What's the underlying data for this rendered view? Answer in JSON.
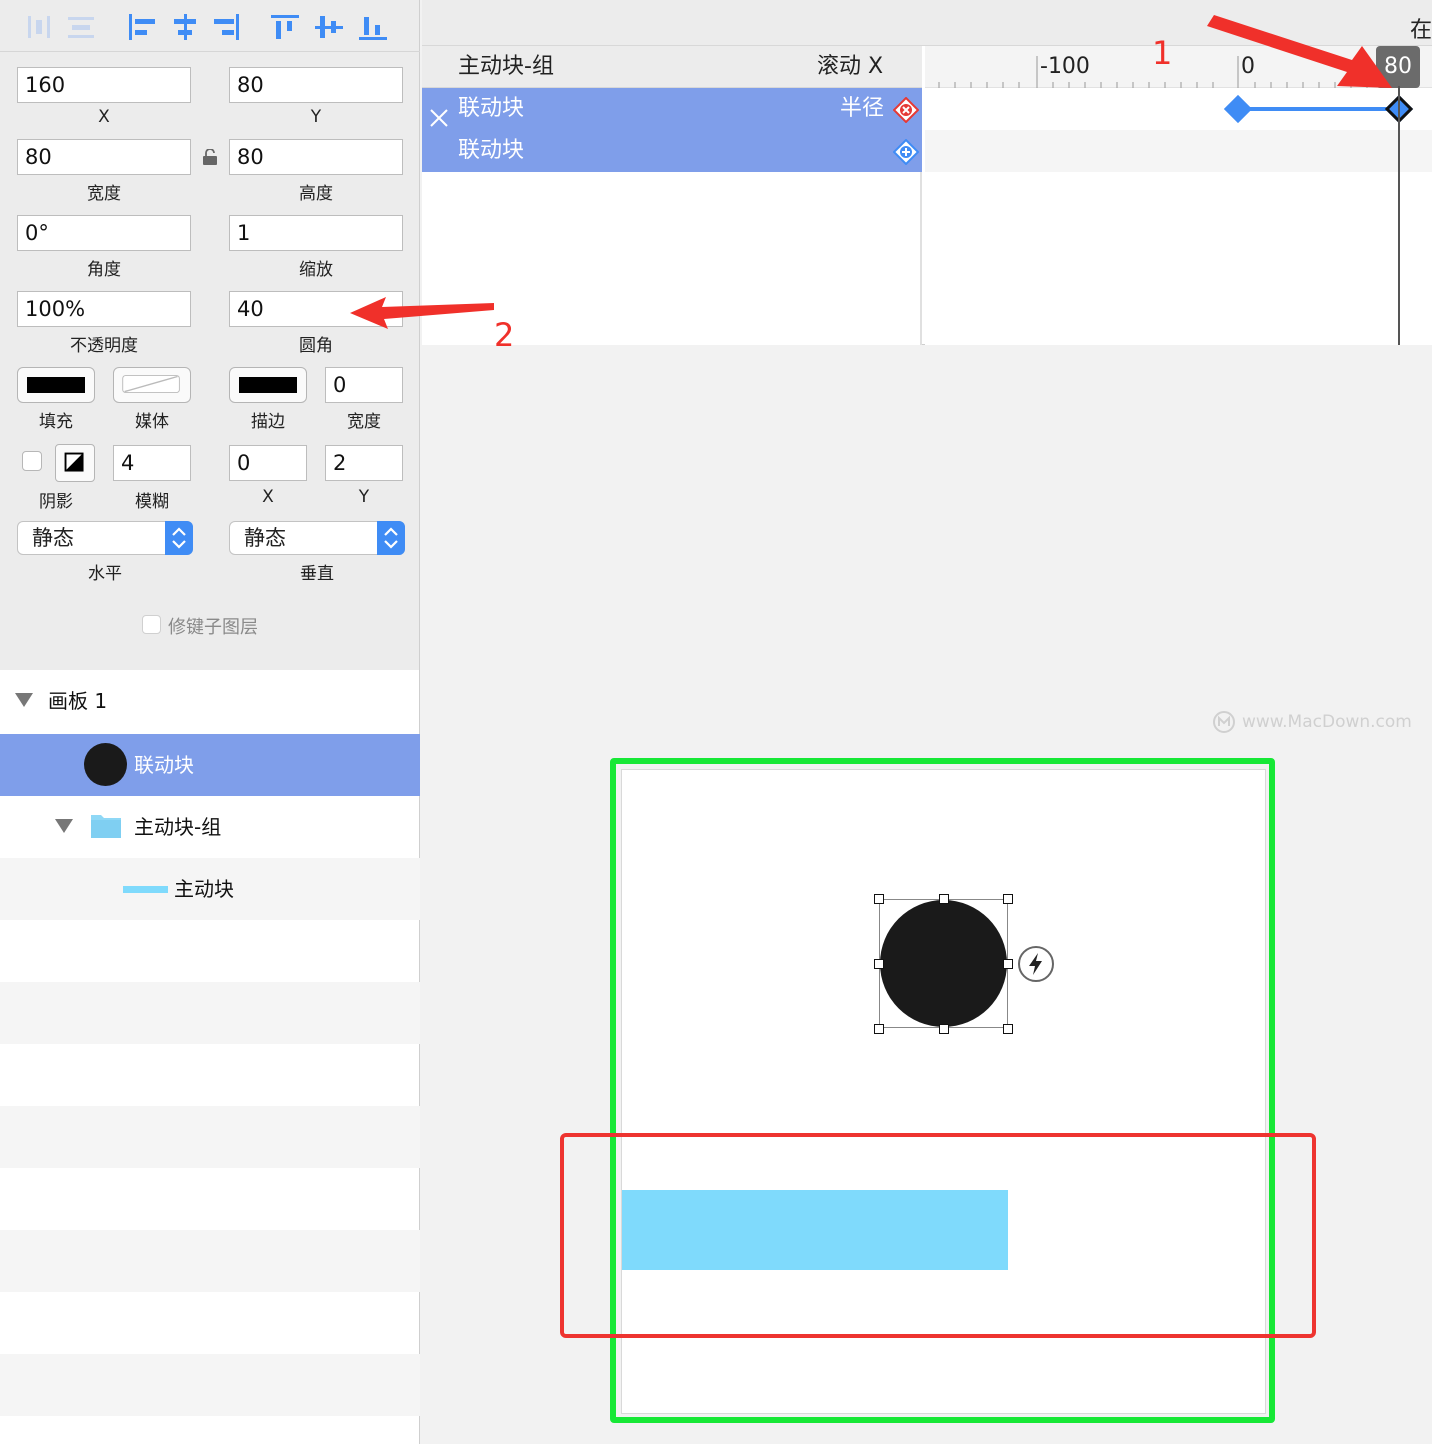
{
  "inspector": {
    "fields": {
      "x": "160",
      "x_label": "X",
      "y": "80",
      "y_label": "Y",
      "width": "80",
      "width_label": "宽度",
      "height": "80",
      "height_label": "高度",
      "angle": "0°",
      "angle_label": "角度",
      "scale": "1",
      "scale_label": "缩放",
      "opacity": "100%",
      "opacity_label": "不透明度",
      "radius": "40",
      "radius_label": "圆角"
    },
    "appearance": {
      "fill_label": "填充",
      "media_label": "媒体",
      "stroke_label": "描边",
      "stroke_width": "0",
      "stroke_width_label": "宽度"
    },
    "shadow": {
      "label": "阴影",
      "blur": "4",
      "blur_label": "模糊",
      "x": "0",
      "x_label": "X",
      "y": "2",
      "y_label": "Y"
    },
    "pins": {
      "horizontal_value": "静态",
      "horizontal_label": "水平",
      "vertical_value": "静态",
      "vertical_label": "垂直"
    },
    "lock_children_label": "修键子图层"
  },
  "layers": {
    "artboard": "画板 1",
    "linked_block": "联动块",
    "group": "主动块-组",
    "main_block": "主动块"
  },
  "timeline": {
    "corner_text": "在",
    "header_group": "主动块-组",
    "header_property": "滚动 X",
    "rows": [
      {
        "name": "联动块",
        "property": "半径"
      },
      {
        "name": "联动块",
        "property": ""
      }
    ],
    "ruler_labels": [
      "-100",
      "0"
    ],
    "playhead_value": "80"
  },
  "annotations": {
    "label_1": "1",
    "label_2": "2",
    "arrow_color": "#f0302a",
    "green_box_color": "#17e836",
    "red_box_color": "#ee3430"
  },
  "canvas": {
    "watermark": "www.MacDown.com"
  },
  "colors": {
    "selection": "#7f9eea",
    "accent": "#3f8cf5",
    "main_block": "#7fdafc",
    "linked_block": "#1a1a1a"
  }
}
